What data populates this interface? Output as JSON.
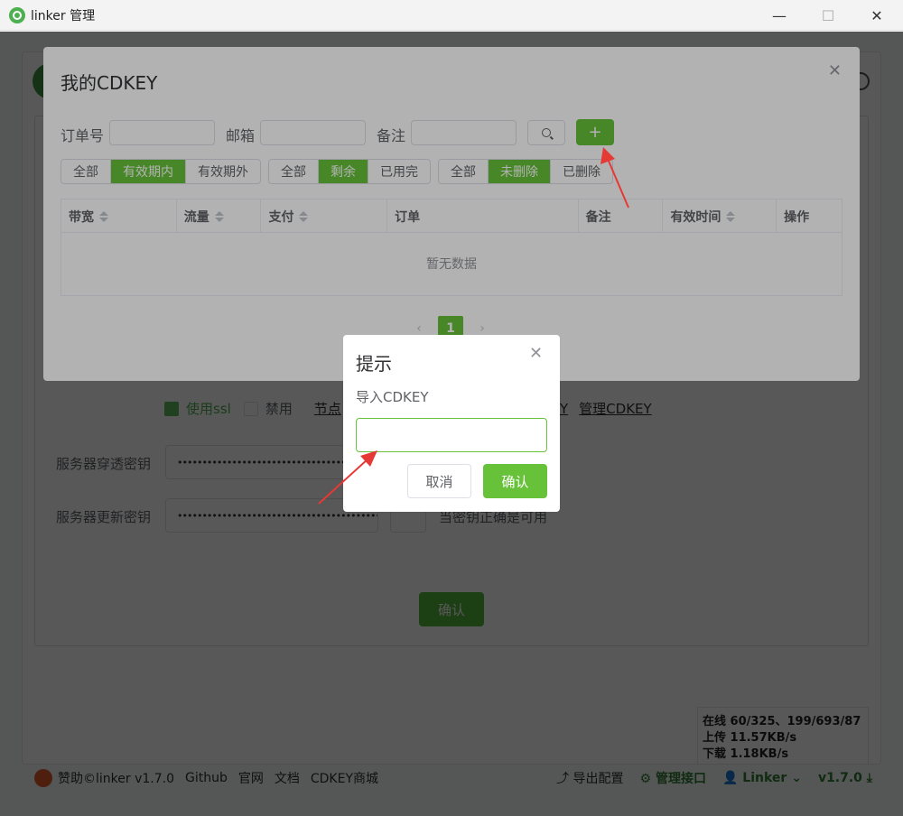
{
  "window": {
    "title": "linker 管理",
    "min": "—",
    "max": "☐",
    "close": "✕"
  },
  "background": {
    "use_ssl": "使用ssl",
    "disable": "禁用",
    "node_link": "节点",
    "cdkey_link_tail": "Y",
    "manage_cdkey_link": "管理CDKEY",
    "server_punch_key_label": "服务器穿透密钥",
    "server_update_key_label": "服务器更新密钥",
    "masked_key": "••••••••••••••••••••••••••••••••••••••••••",
    "key_ok_text": "当密钥正确是可用",
    "confirm": "确认"
  },
  "stats": {
    "online": "在线 60/325、199/693/87",
    "upload": "上传 11.57KB/s",
    "download": "下载 1.18KB/s"
  },
  "footer": {
    "sponsor": "赞助©linker v1.7.0",
    "github": "Github",
    "website": "官网",
    "docs": "文档",
    "cdkey_shop": "CDKEY商城",
    "export_config": "导出配置",
    "manage_api": "管理接口",
    "user": "Linker",
    "version": "v1.7.0"
  },
  "cdkey_dialog": {
    "title": "我的CDKEY",
    "filters": {
      "order_label": "订单号",
      "email_label": "邮箱",
      "remark_label": "备注"
    },
    "add_label": "+",
    "seg_period": [
      "全部",
      "有效期内",
      "有效期外"
    ],
    "seg_period_active": 1,
    "seg_remaining": [
      "全部",
      "剩余",
      "已用完"
    ],
    "seg_remaining_active": 1,
    "seg_deleted": [
      "全部",
      "未删除",
      "已删除"
    ],
    "seg_deleted_active": 1,
    "columns": [
      "带宽",
      "流量",
      "支付",
      "订单",
      "备注",
      "有效时间",
      "操作"
    ],
    "sortable": [
      true,
      true,
      true,
      false,
      false,
      true,
      false
    ],
    "empty_text": "暂无数据",
    "pager": {
      "prev": "‹",
      "page": "1",
      "next": "›"
    }
  },
  "prompt": {
    "title": "提示",
    "message": "导入CDKEY",
    "input_value": "",
    "cancel": "取消",
    "confirm": "确认"
  },
  "colors": {
    "accent": "#67c23a",
    "arrow": "#e53935"
  }
}
